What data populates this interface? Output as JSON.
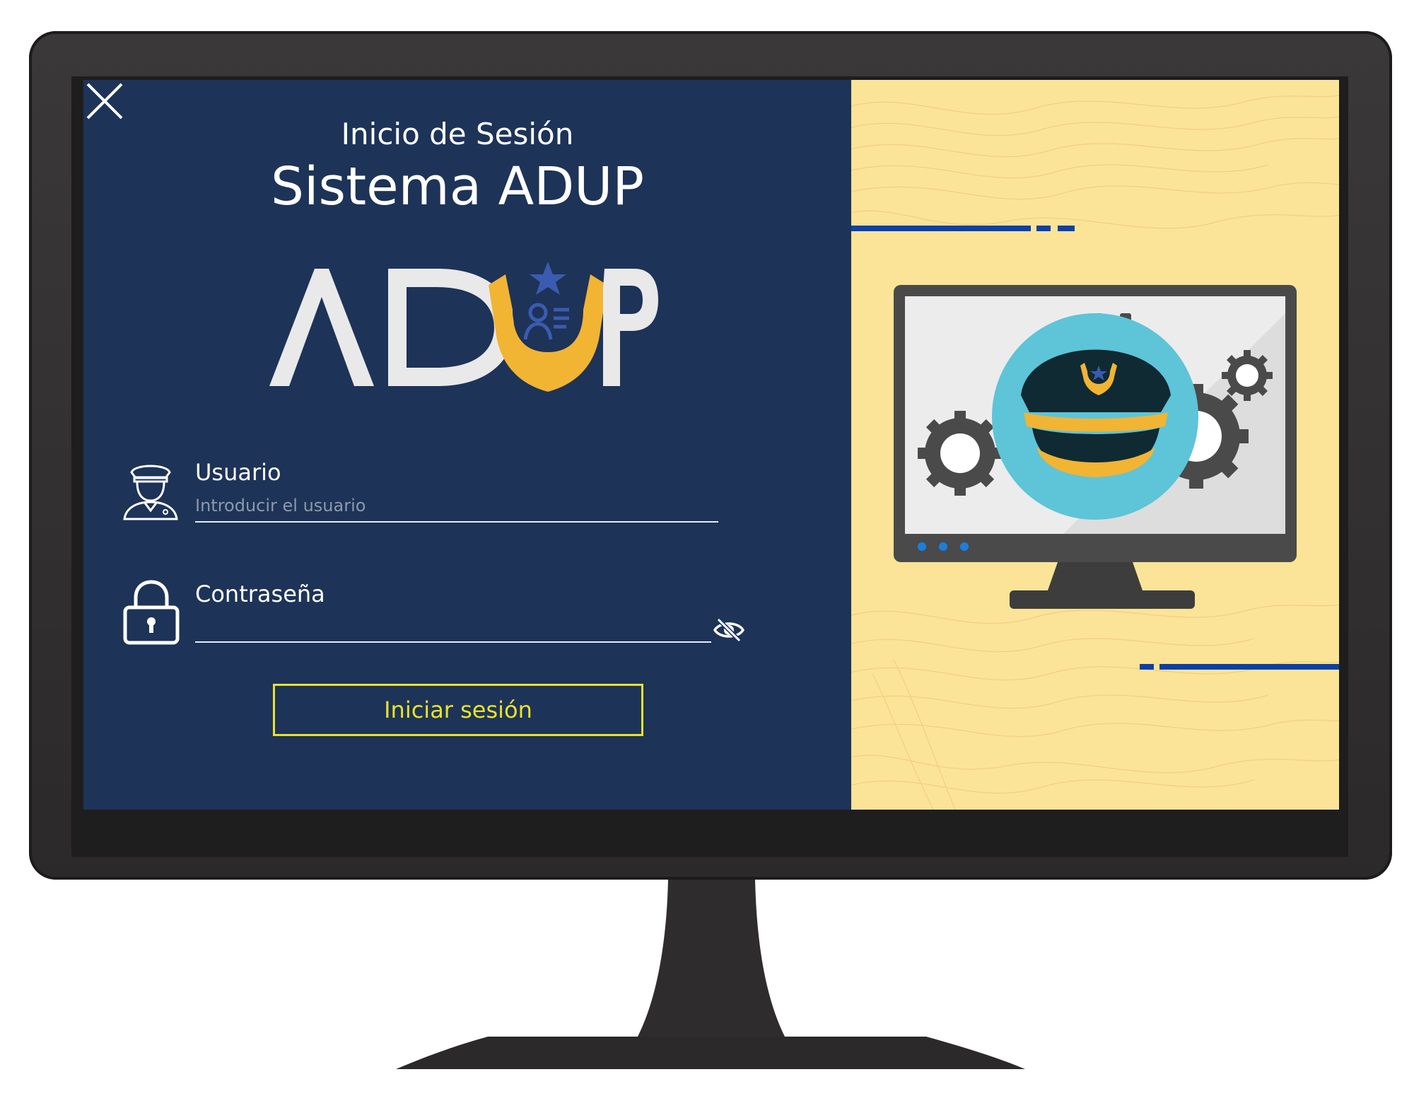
{
  "window": {
    "close_icon": "close-icon"
  },
  "header": {
    "subtitle": "Inicio de Sesión",
    "title": "Sistema ADUP"
  },
  "logo": {
    "text": "ADUP"
  },
  "form": {
    "username": {
      "label": "Usuario",
      "placeholder": "Introducir el usuario",
      "value": "",
      "icon": "police-officer-icon"
    },
    "password": {
      "label": "Contraseña",
      "value": "",
      "icon": "padlock-icon",
      "toggle_icon": "eye-slash-icon"
    },
    "submit_label": "Iniciar sesión"
  },
  "colors": {
    "panel_bg": "#1d3358",
    "illustration_bg": "#fbe497",
    "button_accent": "#e9e22a",
    "logo_gold": "#f2b433",
    "logo_blue": "#3b5bb0"
  }
}
